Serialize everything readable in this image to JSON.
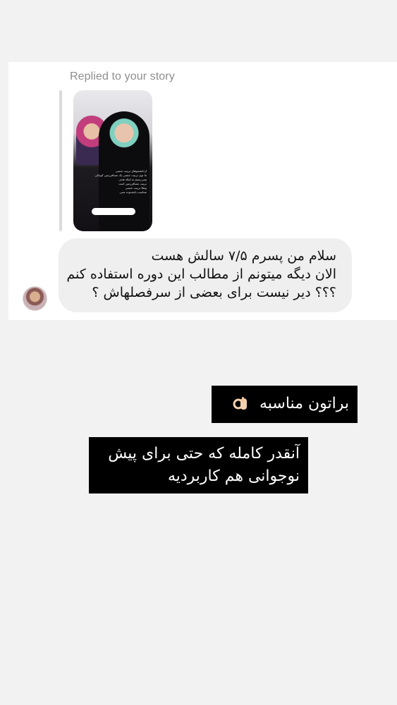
{
  "story_reply": {
    "label": "Replied to your story",
    "thumbnail": {
      "caption_lines": [
        "ازدانشجوهای تربیت جنسی",
        "ما توی تربیت جنسی یک مسافرزمین کوچکی",
        "ومی‌رسیم به اینکه هدف",
        "تربیت مسافرزمین است",
        "ومثلا تربیت جنسی",
        "متناسب بامحدوده سنی"
      ]
    },
    "message_lines": [
      "سلام من پسرم ۷/۵ سالش هست",
      "الان دیگه میتونم از مطالب این دوره استفاده کنم",
      "؟؟؟ دیر نیست برای بعضی از سرفصلهاش ؟"
    ]
  },
  "captions": [
    {
      "lines": [
        "براتون مناسبه"
      ],
      "icon": "ok-hand-icon"
    },
    {
      "lines": [
        "آنقدر کامله که حتی برای پیش",
        "نوجوانی هم کاربردیه"
      ]
    }
  ],
  "colors": {
    "background": "#f2f2f2",
    "bubble": "#efefef",
    "caption_bg": "#000000",
    "label": "#8e8e8e"
  }
}
